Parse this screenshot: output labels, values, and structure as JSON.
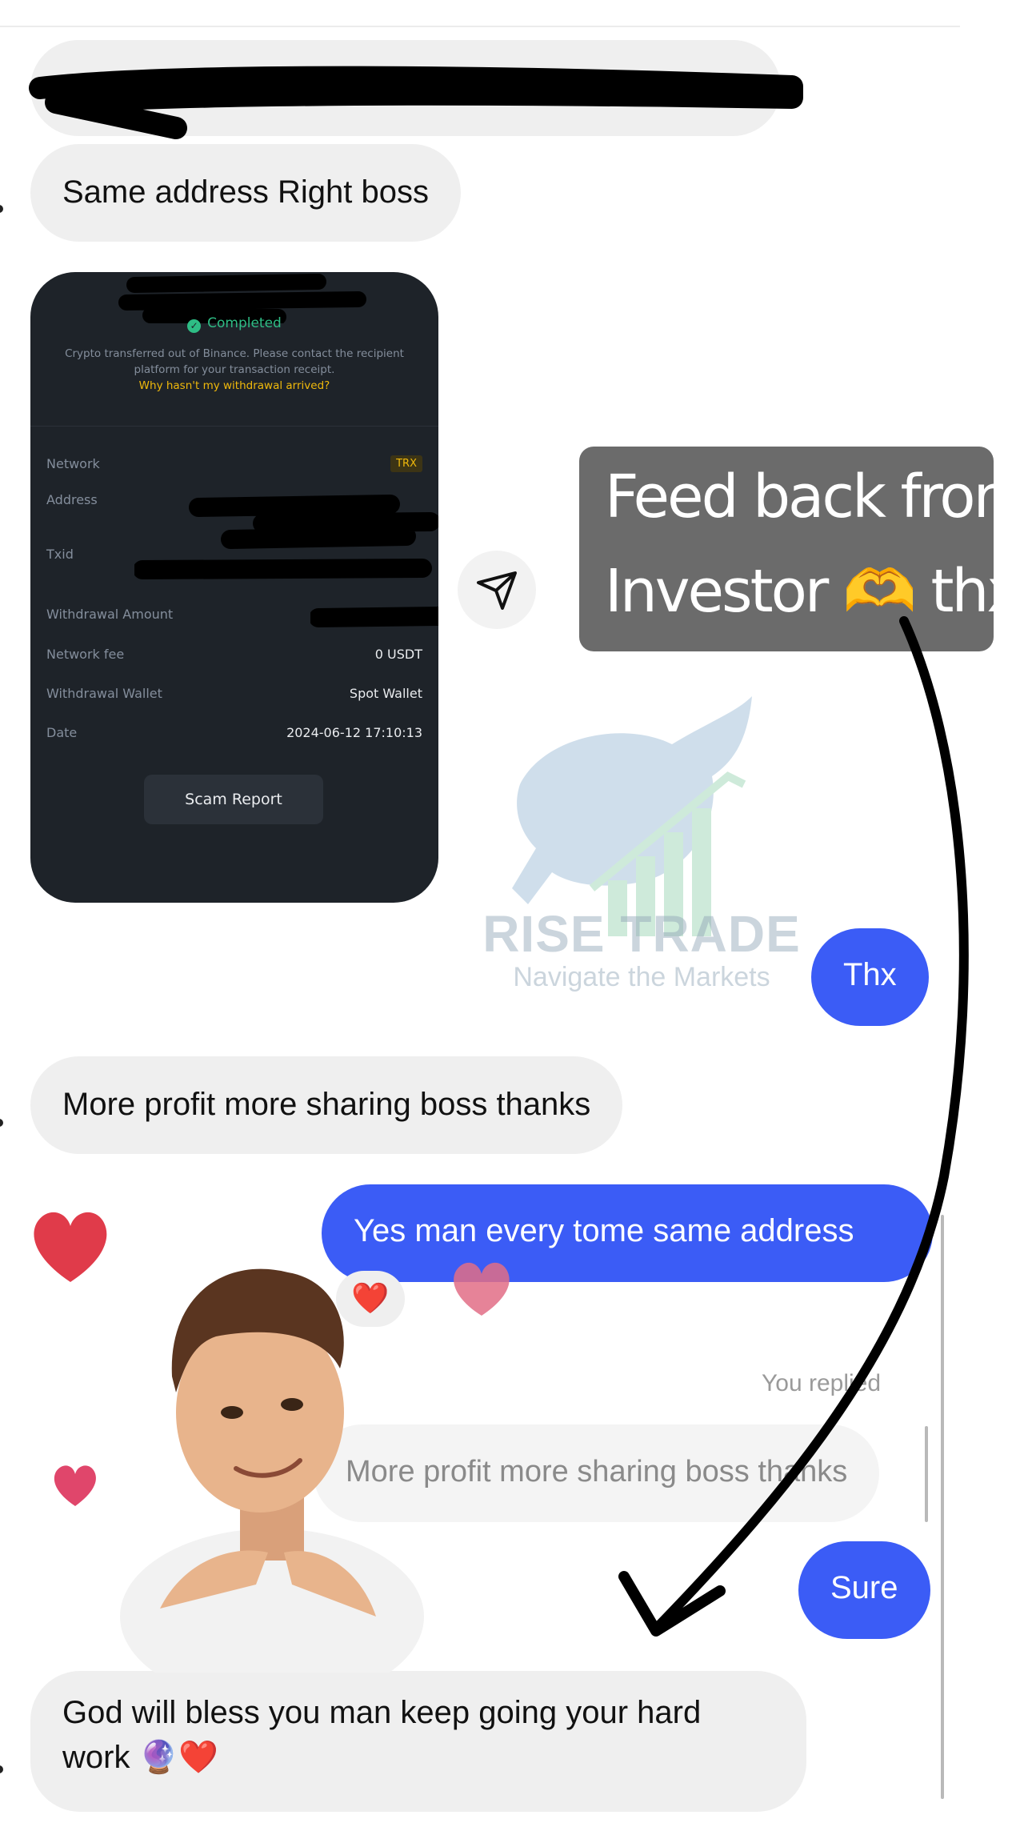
{
  "messages": {
    "m1": "Same address Right boss",
    "m2": "More profit more sharing boss thanks",
    "m3": "God will bless you man keep going your hard",
    "m3_line2": "work 🔮❤️",
    "out1": "Thx",
    "out2": "Yes man every tome same address",
    "out3": "Sure",
    "reaction": "❤️",
    "you_replied": "You replied",
    "quoted": "More profit more sharing boss thanks"
  },
  "receipt": {
    "status": "Completed",
    "message": "Crypto transferred out of Binance. Please contact the recipient platform for your transaction receipt.",
    "help_link": "Why hasn't my withdrawal arrived?",
    "rows": {
      "network_label": "Network",
      "network_value": "TRX",
      "address_label": "Address",
      "txid_label": "Txid",
      "amount_label": "Withdrawal Amount",
      "fee_label": "Network fee",
      "fee_value": "0 USDT",
      "wallet_label": "Withdrawal Wallet",
      "wallet_value": "Spot Wallet",
      "date_label": "Date",
      "date_value": "2024-06-12 17:10:13"
    },
    "scam_button": "Scam Report"
  },
  "story": {
    "caption_line1": "Feed back from",
    "caption_line2": "Investor 🫶 thx"
  },
  "watermark": {
    "title": "RISE TRADE",
    "subtitle": "Navigate the Markets"
  },
  "colors": {
    "outgoing_bubble": "#3b5cf6",
    "incoming_bubble": "#efefef",
    "receipt_bg": "#1e2329",
    "completed_green": "#2ebd85",
    "binance_yellow": "#f0b90b",
    "caption_bg": "#6b6b6b"
  },
  "icons": [
    "send-icon",
    "check-circle-icon",
    "heart-sticker",
    "avatar-sticker",
    "arrow-annotation",
    "bull-logo"
  ]
}
